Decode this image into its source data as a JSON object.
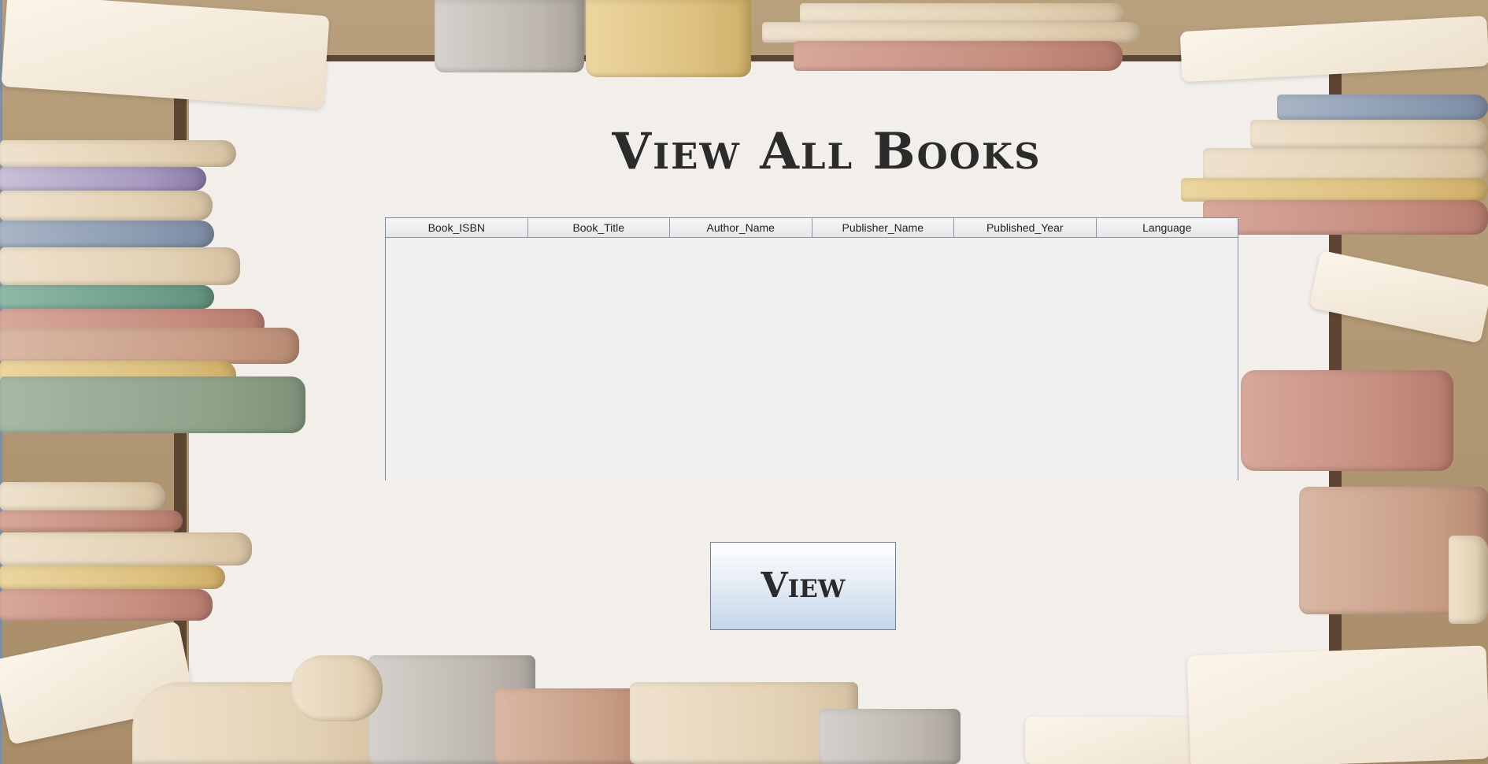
{
  "page": {
    "title": "View All Books"
  },
  "table": {
    "columns": [
      "Book_ISBN",
      "Book_Title",
      "Author_Name",
      "Publisher_Name",
      "Published_Year",
      "Language"
    ],
    "rows": []
  },
  "actions": {
    "view_label": "View"
  },
  "colors": {
    "button_gradient_top": "#ffffff",
    "button_gradient_bottom": "#c4d6ea",
    "paper": "#f2eeea",
    "frame_wood": "#5c4532"
  }
}
